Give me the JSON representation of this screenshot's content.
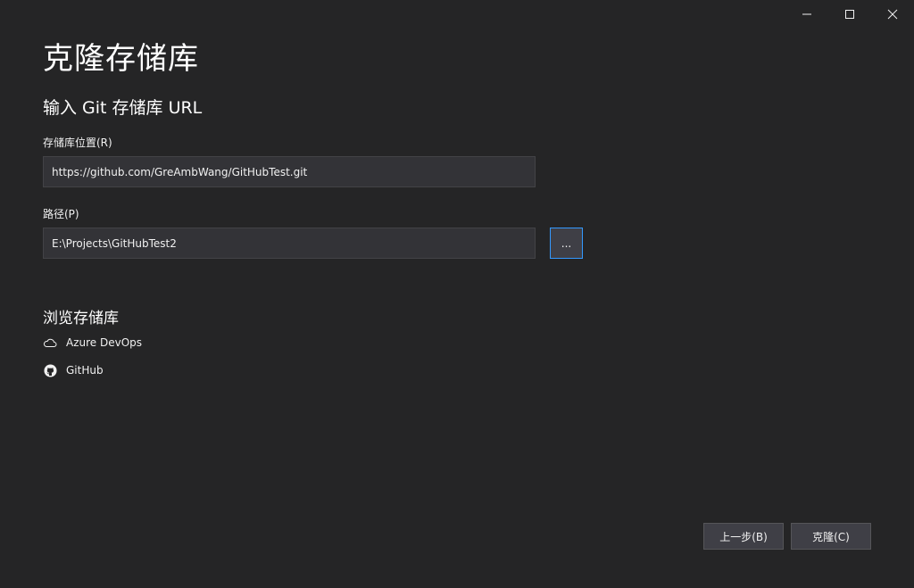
{
  "window": {
    "controls": [
      "minimize-icon",
      "maximize-icon",
      "close-icon"
    ]
  },
  "page": {
    "title": "克隆存储库",
    "subtitle": "输入 Git 存储库 URL"
  },
  "form": {
    "repo_label": "存储库位置(R)",
    "repo_value": "https://github.com/GreAmbWang/GitHubTest.git",
    "path_label": "路径(P)",
    "path_value": "E:\\Projects\\GitHubTest2",
    "browse_label": "..."
  },
  "browse": {
    "title": "浏览存储库",
    "items": [
      {
        "label": "Azure DevOps",
        "icon": "cloud-icon"
      },
      {
        "label": "GitHub",
        "icon": "github-icon"
      }
    ]
  },
  "footer": {
    "back_label": "上一步(B)",
    "clone_label": "克隆(C)"
  },
  "colors": {
    "background": "#252526",
    "input_background": "#333337",
    "accent_border": "#3399ff"
  }
}
